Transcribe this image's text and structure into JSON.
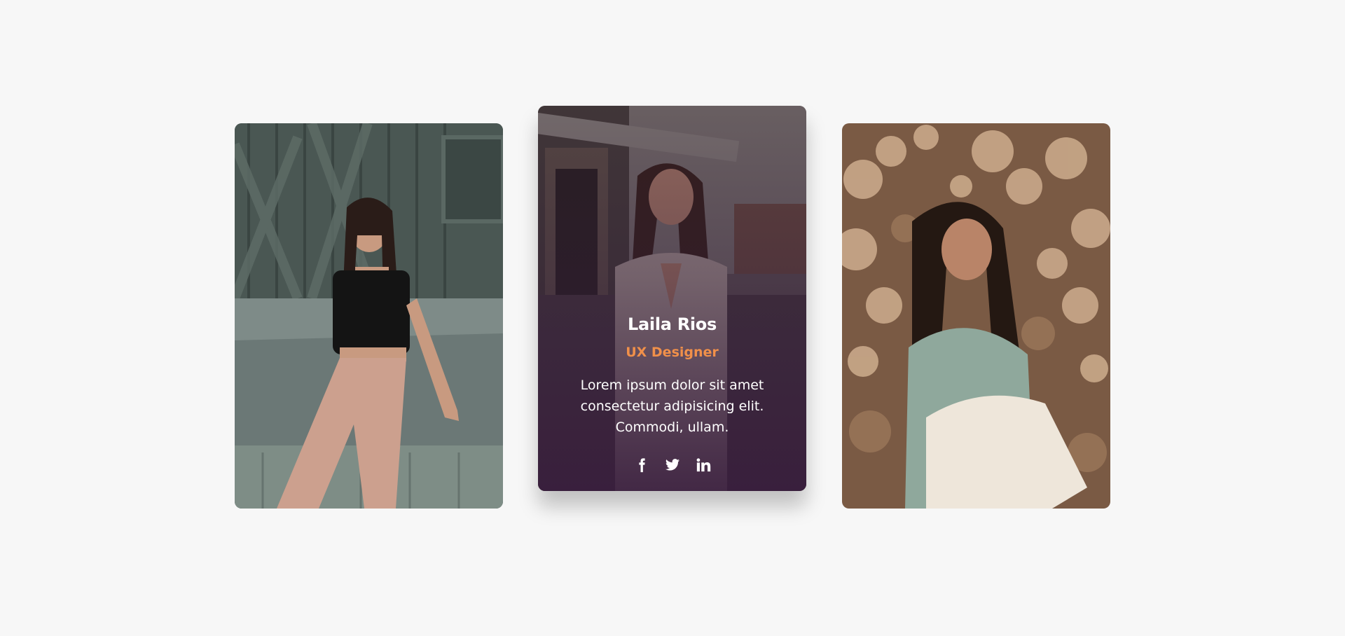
{
  "colors": {
    "background": "#f7f7f7",
    "accent": "#f0904a",
    "overlay": "#3a1d3e"
  },
  "cards": [
    {
      "scene": "woman-seated-on-wooden-porch"
    },
    {
      "scene": "woman-smiling-outdoors",
      "name": "Laila Rios",
      "role": "UX Designer",
      "bio": "Lorem ipsum dolor sit amet consectetur adipisicing elit. Commodi, ullam.",
      "socials": [
        {
          "icon": "facebook-icon"
        },
        {
          "icon": "twitter-icon"
        },
        {
          "icon": "linkedin-icon"
        }
      ]
    },
    {
      "scene": "woman-in-dried-flower-field"
    }
  ]
}
